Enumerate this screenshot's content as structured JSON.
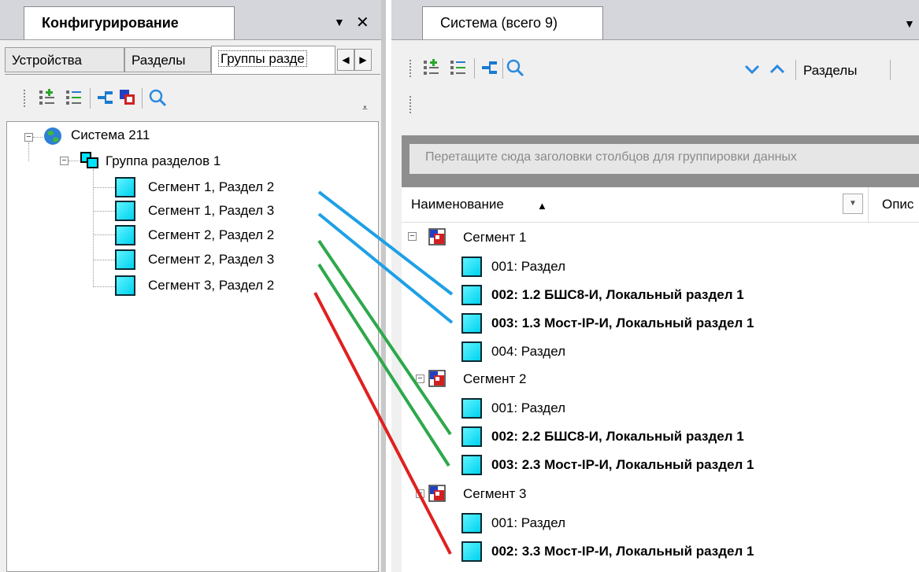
{
  "left_panel": {
    "title": "Конфигурирование",
    "pin_icon": "▼",
    "close_icon": "✕",
    "tabs": [
      "Устройства",
      "Разделы",
      "Группы разделов"
    ],
    "tabs_visible": [
      "Устройства",
      "Разделы",
      "Группы разде"
    ],
    "active_tab": "Группы разделов",
    "toolbar_icons": [
      "add-item-icon",
      "tree-list-icon",
      "link-icon",
      "copy-icon",
      "search-icon"
    ],
    "tree": {
      "root": "Система 211",
      "group": "Группа разделов 1",
      "items": [
        "Сегмент 1, Раздел 2",
        "Сегмент 1, Раздел 3",
        "Сегмент 2, Раздел 2",
        "Сегмент 2, Раздел 3",
        "Сегмент 3, Раздел 2"
      ]
    }
  },
  "right_panel": {
    "title": "Система (всего 9)",
    "toolbar_icons": [
      "add-item-icon",
      "tree-list-icon",
      "link-icon",
      "search-icon",
      "chevron-down-icon",
      "chevron-up-icon"
    ],
    "toolbar_label": "Разделы",
    "group_hint": "Перетащите сюда заголовки столбцов для группировки данных",
    "columns": [
      "Наименование",
      "Описание"
    ],
    "columns_visible": [
      "Наименование",
      "Опис"
    ],
    "sort_indicator": "▲",
    "segments": [
      {
        "name": "Сегмент 1",
        "rows": [
          {
            "label": "001: Раздел",
            "bold": false
          },
          {
            "label": "002: 1.2 БШС8-И, Локальный раздел 1",
            "bold": true
          },
          {
            "label": "003: 1.3 Мост-IP-И, Локальный раздел 1",
            "bold": true
          },
          {
            "label": "004: Раздел",
            "bold": false
          }
        ]
      },
      {
        "name": "Сегмент 2",
        "rows": [
          {
            "label": "001: Раздел",
            "bold": false
          },
          {
            "label": "002: 2.2 БШС8-И, Локальный раздел 1",
            "bold": true
          },
          {
            "label": "003: 2.3 Мост-IP-И, Локальный раздел 1",
            "bold": true
          }
        ]
      },
      {
        "name": "Сегмент 3",
        "rows": [
          {
            "label": "001: Раздел",
            "bold": false
          },
          {
            "label": "002: 3.3 Мост-IP-И, Локальный раздел 1",
            "bold": true
          }
        ]
      }
    ]
  },
  "connector_colors": {
    "segment1": "#1ea0e6",
    "segment2": "#2ea84a",
    "segment3": "#e02020"
  },
  "colors": {
    "accent_cyan": "#00e5ff",
    "panel_bg": "#f0f0f0",
    "group_bar": "#8e8e8e"
  }
}
